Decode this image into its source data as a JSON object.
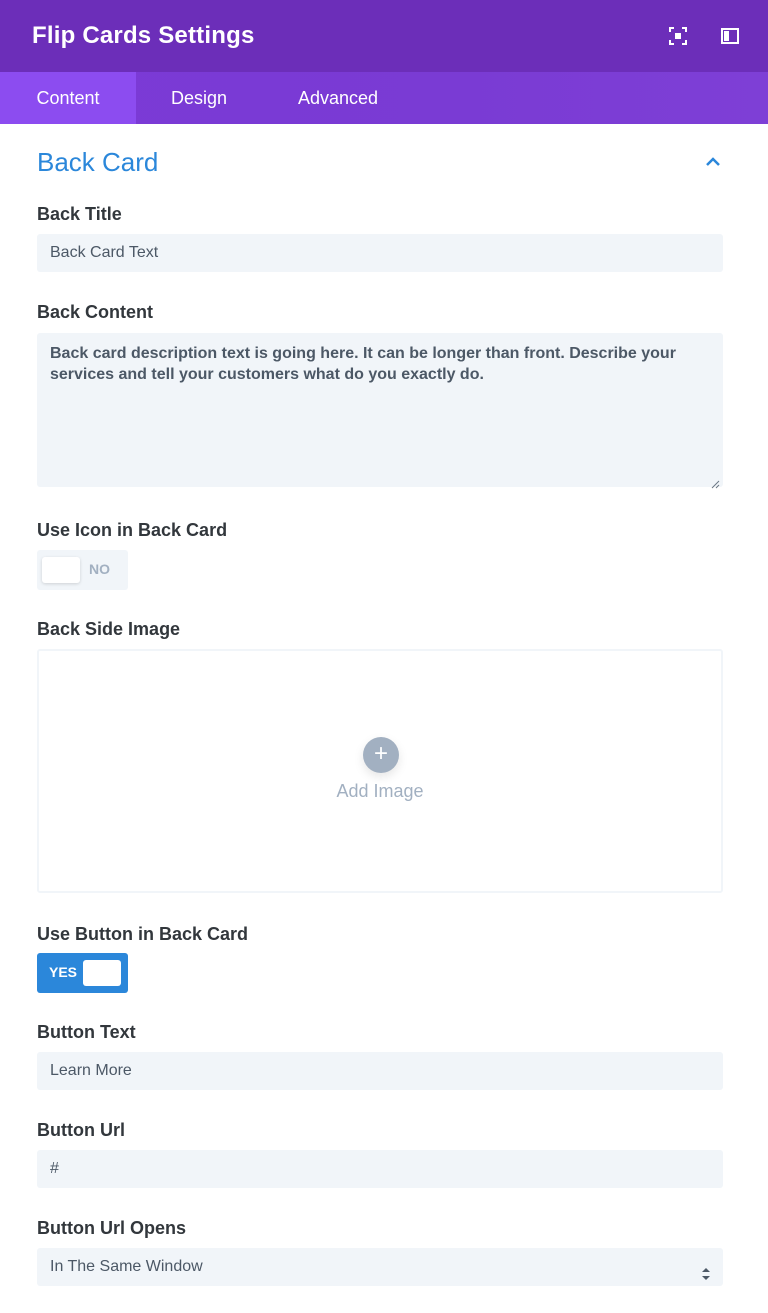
{
  "header": {
    "title": "Flip Cards Settings"
  },
  "tabs": [
    {
      "label": "Content"
    },
    {
      "label": "Design"
    },
    {
      "label": "Advanced"
    }
  ],
  "section": {
    "title": "Back Card"
  },
  "fields": {
    "back_title": {
      "label": "Back Title",
      "value": "Back Card Text"
    },
    "back_content": {
      "label": "Back Content",
      "value": "Back card description text is going here. It can be longer than front. Describe your services and tell your customers what do you exactly do."
    },
    "use_icon": {
      "label": "Use Icon in Back Card",
      "state": "NO"
    },
    "back_image": {
      "label": "Back Side Image",
      "add_label": "Add Image",
      "add_symbol": "+"
    },
    "use_button": {
      "label": "Use Button in Back Card",
      "state": "YES"
    },
    "button_text": {
      "label": "Button Text",
      "value": "Learn More"
    },
    "button_url": {
      "label": "Button Url",
      "value": "#"
    },
    "button_url_opens": {
      "label": "Button Url Opens",
      "value": "In The Same Window"
    }
  },
  "colors": {
    "header_bg": "#6c2eb9",
    "tabs_bg": "#7b39d6",
    "active_tab": "#8c4cf0",
    "accent_blue": "#2b87da",
    "field_bg": "#f1f5f9",
    "muted": "#a2b0c1"
  },
  "icons": {
    "header_left": "expand-focus-icon",
    "header_right": "sidebar-layout-icon",
    "section_toggle": "chevron-up-icon",
    "select_arrows": "sort-arrows-icon"
  }
}
